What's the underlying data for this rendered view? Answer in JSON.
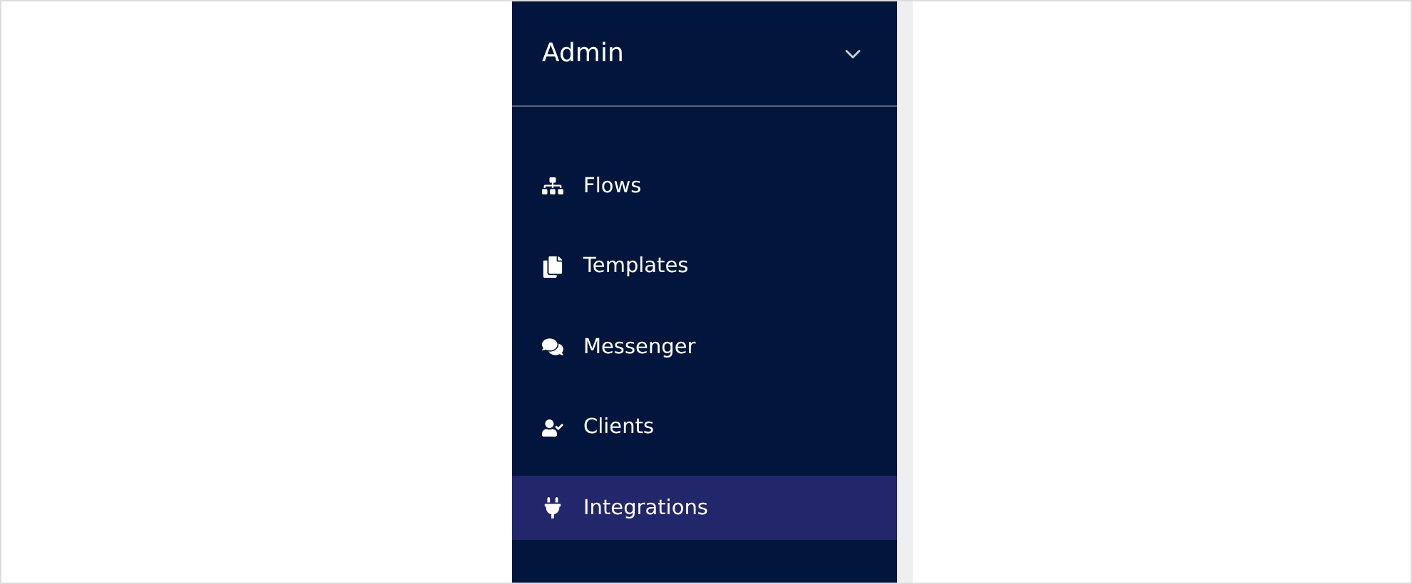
{
  "sidebar": {
    "header": {
      "title": "Admin",
      "expanded": false
    },
    "items": [
      {
        "label": "Flows",
        "selected": false
      },
      {
        "label": "Templates",
        "selected": false
      },
      {
        "label": "Messenger",
        "selected": false
      },
      {
        "label": "Clients",
        "selected": false
      },
      {
        "label": "Integrations",
        "selected": true
      }
    ]
  }
}
